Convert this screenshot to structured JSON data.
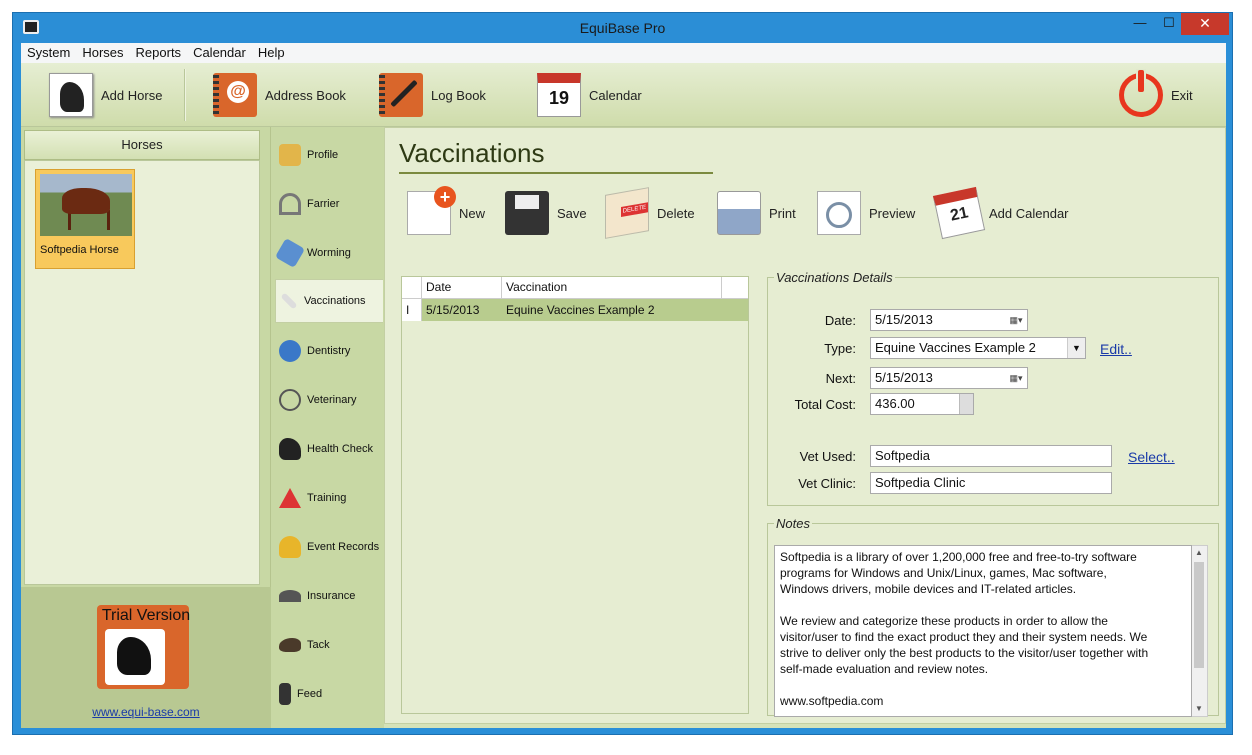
{
  "window": {
    "title": "EquiBase Pro"
  },
  "menu": [
    "System",
    "Horses",
    "Reports",
    "Calendar",
    "Help"
  ],
  "toolbar": {
    "add_horse": "Add Horse",
    "address_book": "Address Book",
    "log_book": "Log Book",
    "calendar": "Calendar",
    "calendar_day": "19",
    "exit": "Exit"
  },
  "horses_panel": {
    "header": "Horses",
    "horses": [
      {
        "name": "Softpedia Horse"
      }
    ],
    "trial_label": "Trial Version",
    "website": "www.equi-base.com"
  },
  "nav": [
    {
      "label": "Profile",
      "icon": "profile-icon"
    },
    {
      "label": "Farrier",
      "icon": "horseshoe-icon"
    },
    {
      "label": "Worming",
      "icon": "worming-icon"
    },
    {
      "label": "Vaccinations",
      "icon": "syringe-icon"
    },
    {
      "label": "Dentistry",
      "icon": "tooth-icon"
    },
    {
      "label": "Veterinary",
      "icon": "stethoscope-icon"
    },
    {
      "label": "Health Check",
      "icon": "horse-icon"
    },
    {
      "label": "Training",
      "icon": "training-icon"
    },
    {
      "label": "Event Records",
      "icon": "trophy-icon"
    },
    {
      "label": "Insurance",
      "icon": "umbrella-icon"
    },
    {
      "label": "Tack",
      "icon": "saddle-icon"
    },
    {
      "label": "Feed",
      "icon": "feed-icon"
    }
  ],
  "page": {
    "title": "Vaccinations",
    "actions": {
      "new": "New",
      "save": "Save",
      "delete": "Delete",
      "print": "Print",
      "preview": "Preview",
      "add_calendar": "Add Calendar",
      "add_calendar_day": "21"
    },
    "grid": {
      "columns": [
        "Date",
        "Vaccination"
      ],
      "rows": [
        {
          "date": "5/15/2013",
          "vaccination": "Equine Vaccines Example 2"
        }
      ]
    },
    "details": {
      "legend": "Vaccinations Details",
      "date_label": "Date:",
      "date_value": "5/15/2013",
      "type_label": "Type:",
      "type_value": "Equine Vaccines Example 2",
      "edit_link": "Edit..",
      "next_label": "Next:",
      "next_value": "5/15/2013",
      "total_cost_label": "Total Cost:",
      "total_cost_value": "436.00",
      "vet_used_label": "Vet Used:",
      "vet_used_value": "Softpedia",
      "select_link": "Select..",
      "vet_clinic_label": "Vet Clinic:",
      "vet_clinic_value": "Softpedia Clinic"
    },
    "notes": {
      "legend": "Notes",
      "text": "Softpedia is a library of over 1,200,000 free and free-to-try software\nprograms for Windows and Unix/Linux, games, Mac software,\nWindows drivers, mobile devices and IT-related articles.\n\nWe review and categorize these products in order to allow the\nvisitor/user to find the exact product they and their system needs. We\nstrive to deliver only the best products to the visitor/user together with\nself-made evaluation and review notes.\n\nwww.softpedia.com"
    }
  },
  "colors": {
    "titlebar": "#2b8ed6",
    "panel_green": "#c8d8a4",
    "selected_row": "#b8cc8e",
    "selected_horse": "#f8c95c",
    "accent_orange": "#d9662b",
    "exit_red": "#e8361e"
  }
}
